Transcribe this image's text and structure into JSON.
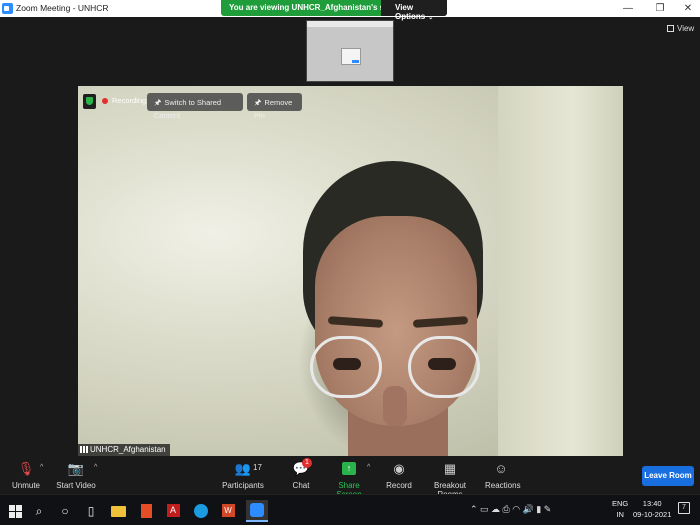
{
  "window": {
    "title": "Zoom Meeting - UNHCR",
    "minimize": "—",
    "restore": "❐",
    "close": "✕"
  },
  "banner": {
    "viewing_text": "You are viewing UNHCR_Afghanistan's screen",
    "view_options": "View Options",
    "chevron": "⌄"
  },
  "top_right": {
    "view_label": "View"
  },
  "video": {
    "recording_label": "Recording",
    "switch_shared_label": "Switch to Shared Content",
    "remove_pin_label": "Remove Pin",
    "pin_glyph": "🖈",
    "participant_name": "UNHCR_Afghanistan"
  },
  "toolbar": {
    "unmute": {
      "label": "Unmute",
      "icon": "🎙"
    },
    "start_video": {
      "label": "Start Video",
      "icon": "📷"
    },
    "caret": "^",
    "participants": {
      "label": "Participants",
      "icon": "👥",
      "count": "17"
    },
    "chat": {
      "label": "Chat",
      "icon": "💬",
      "badge": "1"
    },
    "share_screen": {
      "label": "Share Screen",
      "icon": "↑"
    },
    "record": {
      "label": "Record",
      "icon": "◉"
    },
    "breakout": {
      "label": "Breakout Rooms",
      "icon": "▦"
    },
    "reactions": {
      "label": "Reactions",
      "icon": "☺"
    },
    "leave": "Leave Room"
  },
  "taskbar": {
    "search_icon": "⌕",
    "cortana_icon": "○",
    "taskview_icon": "▯",
    "acrobat_glyph": "A",
    "word_glyph": "W",
    "tray_icons": "⌃  ▭  ☁  ⎙  ◠  🔊  ▮  ✎",
    "lang_line1": "ENG",
    "lang_line2": "IN",
    "time": "13:40",
    "date": "09-10-2021",
    "notif_count": "7"
  },
  "colors": {
    "accent_green": "#1f9d3b",
    "leave_blue": "#1a6fe0",
    "mute_red": "#e34b4b",
    "zoom_blue": "#2d8cff"
  }
}
